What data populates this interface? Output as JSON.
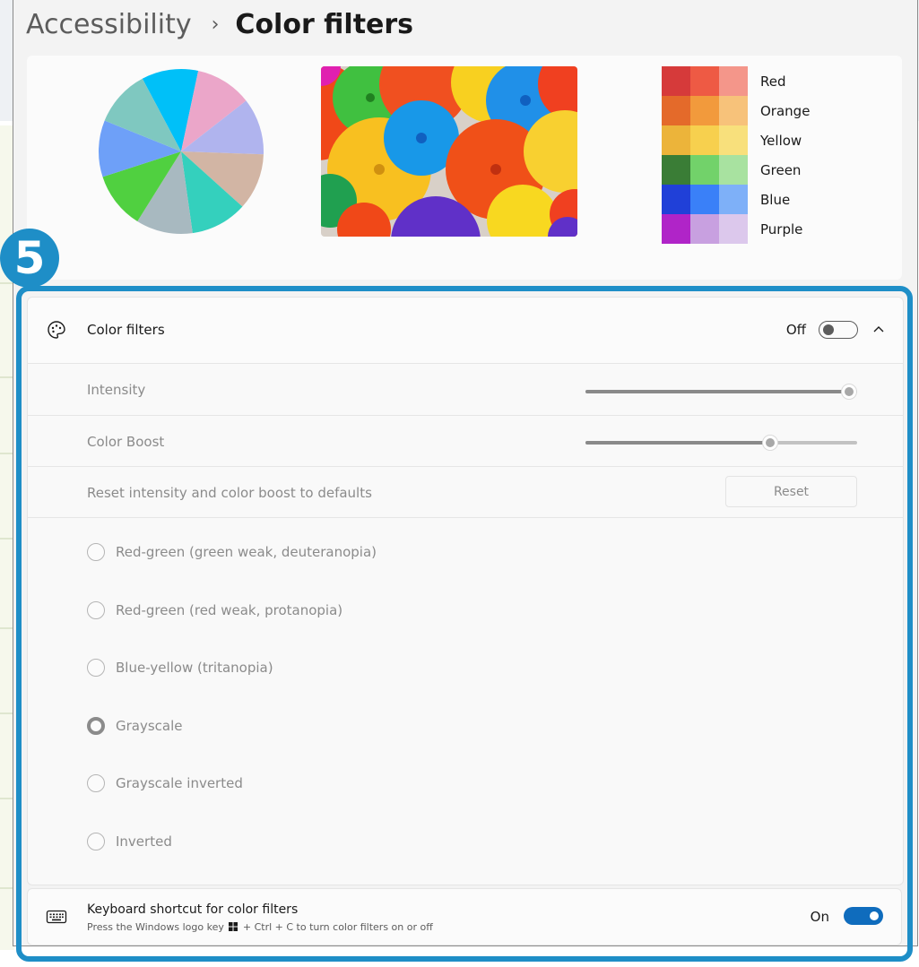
{
  "header": {
    "parent": "Accessibility",
    "separator": "›",
    "current": "Color filters"
  },
  "preview": {
    "pie_colors": [
      "#00c0f8",
      "#eba6c9",
      "#b0b4ee",
      "#d2b5a4",
      "#34d0bd",
      "#a8b9c0",
      "#50d040",
      "#6ea0f8",
      "#7fc8c0"
    ],
    "swatches": [
      {
        "label": "Red",
        "colors": [
          "#d63a3a",
          "#ee5a44",
          "#f4968a"
        ]
      },
      {
        "label": "Orange",
        "colors": [
          "#e46a2a",
          "#f29a3c",
          "#f7c27a"
        ]
      },
      {
        "label": "Yellow",
        "colors": [
          "#ecb43a",
          "#f7d04e",
          "#f8e07c"
        ]
      },
      {
        "label": "Green",
        "colors": [
          "#3a7d36",
          "#72d26a",
          "#a8e2a0"
        ]
      },
      {
        "label": "Blue",
        "colors": [
          "#2040d8",
          "#3a80f8",
          "#7eb0f8"
        ]
      },
      {
        "label": "Purple",
        "colors": [
          "#b024c8",
          "#c8a0e0",
          "#dcc8ec"
        ]
      }
    ]
  },
  "step_badge": "5",
  "color_filters": {
    "label": "Color filters",
    "state": "Off",
    "enabled": false,
    "intensity": {
      "label": "Intensity",
      "value": 1.0
    },
    "color_boost": {
      "label": "Color Boost",
      "value": 0.68
    },
    "reset": {
      "label": "Reset intensity and color boost to defaults",
      "button": "Reset"
    },
    "filters": [
      {
        "label": "Red-green (green weak, deuteranopia)",
        "selected": false
      },
      {
        "label": "Red-green (red weak, protanopia)",
        "selected": false
      },
      {
        "label": "Blue-yellow (tritanopia)",
        "selected": false
      },
      {
        "label": "Grayscale",
        "selected": true
      },
      {
        "label": "Grayscale inverted",
        "selected": false
      },
      {
        "label": "Inverted",
        "selected": false
      }
    ]
  },
  "keyboard_shortcut": {
    "title": "Keyboard shortcut for color filters",
    "desc_before": "Press the Windows logo key",
    "desc_after": "+ Ctrl + C to turn color filters on or off",
    "state": "On",
    "enabled": true
  },
  "colors": {
    "accent": "#1e8ec7",
    "toggle_on": "#0f6cbd"
  }
}
